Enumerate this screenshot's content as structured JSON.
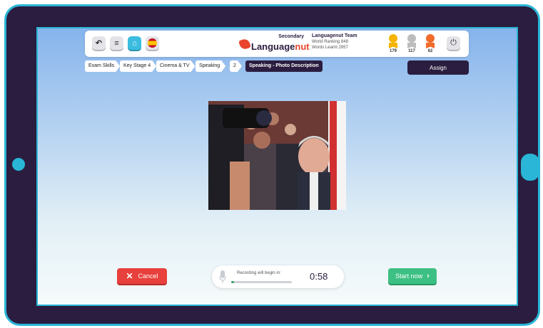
{
  "toolbar": {
    "back_icon": "undo-icon",
    "menu_icon": "menu-icon",
    "home_icon": "home-icon",
    "language_flag": "spain-flag-icon",
    "power_icon": "power-icon"
  },
  "logo": {
    "tier": "Secondary",
    "name_part1": "Language",
    "name_part2": "nut"
  },
  "user": {
    "team": "Languagenut Team",
    "world_ranking": "World Ranking 848",
    "words_learnt": "Words Learnt 2957"
  },
  "medals": [
    {
      "type": "gold",
      "count": "179"
    },
    {
      "type": "silver",
      "count": "117"
    },
    {
      "type": "bronze",
      "count": "62"
    }
  ],
  "breadcrumbs": [
    "Exam Skills",
    "Key Stage 4",
    "Cinema & TV",
    "Speaking",
    "2",
    "Speaking - Photo Description"
  ],
  "assign_label": "Assign",
  "cancel_label": "Cancel",
  "recording": {
    "label": "Recording will begin in:",
    "countdown": "0:58",
    "progress": 0.05
  },
  "start_label": "Start now",
  "colors": {
    "frame": "#2a1d3f",
    "accent": "#2ab6d6",
    "cancel": "#e8403c",
    "start": "#3cc083"
  }
}
